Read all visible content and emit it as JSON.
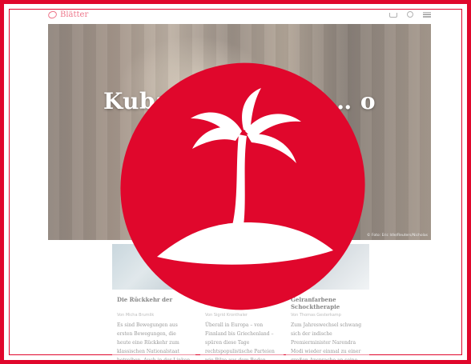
{
  "site": {
    "logo_text": "Blätter"
  },
  "hero": {
    "title": "Kuba … Eric Idle … o",
    "credit": "© Foto: Eric Idle/Reuters/Nicholas"
  },
  "cards": [
    {
      "title": "Die Rückkehr der",
      "author": "Von Micha Brumlik",
      "excerpt": "Es sind Bewegungen aus ersten Bewegungen, die heute eine Rückkehr zum klassischen Nationalstaat betreiben. Auch in der Linken …"
    },
    {
      "title": "",
      "author": "Von Sigrid Kronthaler",
      "excerpt": "Überall in Europa – von Finnland bis Griechenland – spüren diese Tage rechtspopulistische Parteien wie Pilze aus dem Boden."
    },
    {
      "title": "Gelranfarbene Schocktherapie",
      "author": "Von Thomas Gesterkamp",
      "excerpt": "Zum Jahreswechsel schwang sich der indische Premierminister Narendra Modi wieder einmal zu einer großen Ansprache an seine Landsleute auf."
    }
  ],
  "colors": {
    "brand": "#e0072c",
    "badge_icon": "palm-island"
  }
}
